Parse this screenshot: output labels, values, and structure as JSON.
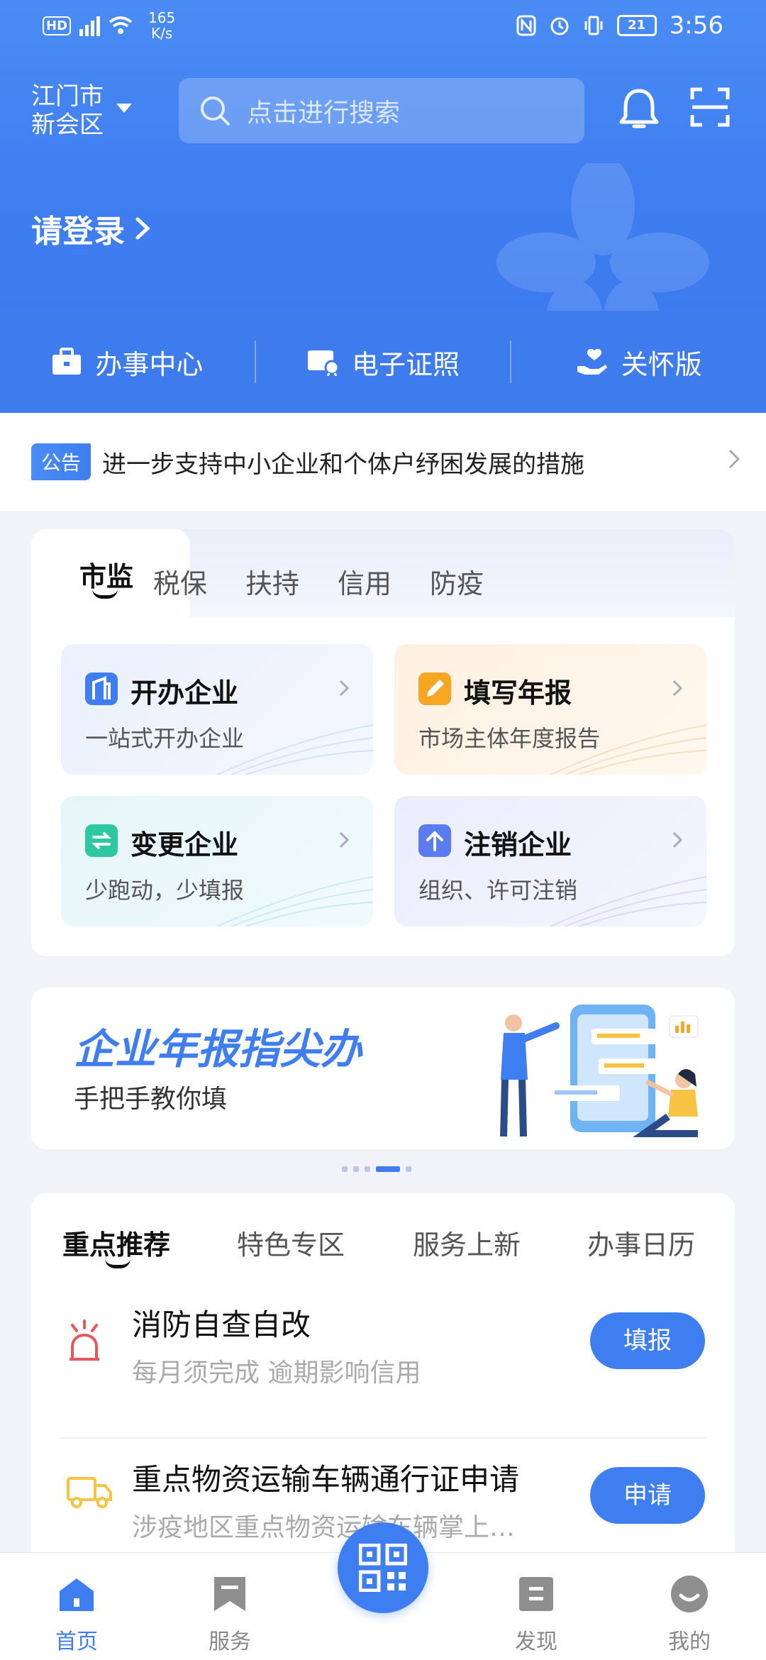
{
  "status_bar": {
    "speed_value": "165",
    "speed_unit": "K/s",
    "battery": "21",
    "time": "3:56"
  },
  "header": {
    "location_line1": "江门市",
    "location_line2": "新会区",
    "search_placeholder": "点击进行搜索",
    "login_label": "请登录"
  },
  "quick_actions": [
    {
      "label": "办事中心",
      "icon": "briefcase-icon"
    },
    {
      "label": "电子证照",
      "icon": "certificate-icon"
    },
    {
      "label": "关怀版",
      "icon": "care-hand-icon"
    }
  ],
  "notice": {
    "tag": "公告",
    "text": "进一步支持中小企业和个体户纾困发展的措施"
  },
  "category_tabs": [
    "市监",
    "税保",
    "扶持",
    "信用",
    "防疫"
  ],
  "services": [
    {
      "title": "开办企业",
      "subtitle": "一站式开办企业",
      "icon": "building-icon",
      "color": "#3f7ef0"
    },
    {
      "title": "填写年报",
      "subtitle": "市场主体年度报告",
      "icon": "pencil-icon",
      "color": "#f6a623"
    },
    {
      "title": "变更企业",
      "subtitle": "少跑动，少填报",
      "icon": "swap-icon",
      "color": "#2ec8a0"
    },
    {
      "title": "注销企业",
      "subtitle": "组织、许可注销",
      "icon": "upload-arrow-icon",
      "color": "#5b7cf0"
    }
  ],
  "banner": {
    "title": "企业年报指尖办",
    "subtitle": "手把手教你填"
  },
  "recommend_tabs": [
    "重点推荐",
    "特色专区",
    "服务上新",
    "办事日历"
  ],
  "recommend_items": [
    {
      "title": "消防自查自改",
      "desc": "每月须完成 逾期影响信用",
      "button": "填报",
      "icon": "alarm-light-icon"
    },
    {
      "title": "重点物资运输车辆通行证申请",
      "desc": "涉疫地区重点物资运输车辆掌上…",
      "button": "申请",
      "icon": "truck-icon"
    }
  ],
  "bottom_nav": [
    {
      "label": "首页",
      "icon": "home-icon"
    },
    {
      "label": "服务",
      "icon": "bookmark-icon"
    },
    {
      "label": "发现",
      "icon": "discover-icon"
    },
    {
      "label": "我的",
      "icon": "profile-icon"
    }
  ],
  "colors": {
    "primary": "#3f7ef0"
  }
}
